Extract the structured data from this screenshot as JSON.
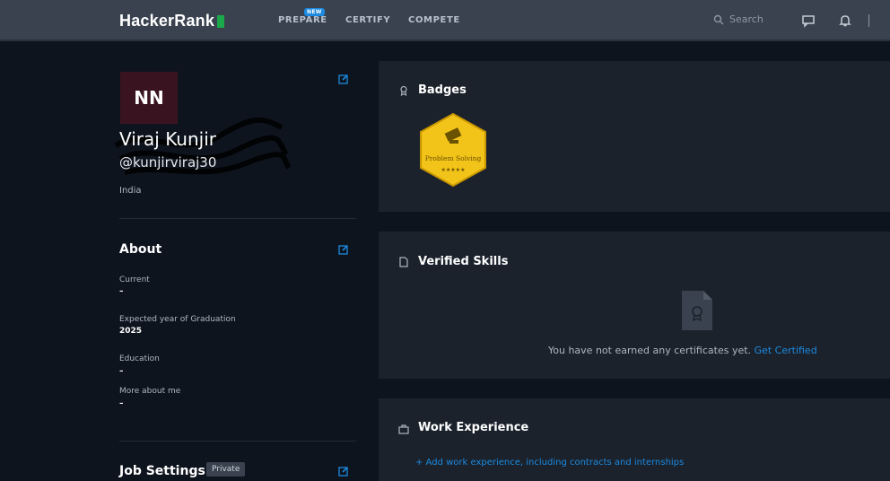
{
  "nav": {
    "brand": "HackerRank",
    "prepare": "PREPARE",
    "new_badge": "NEW",
    "certify": "CERTIFY",
    "compete": "COMPETE",
    "search_placeholder": "Search"
  },
  "profile": {
    "avatar_initials": "NN",
    "name": "Viraj Kunjir",
    "username": "@kunjirviraj30",
    "country": "India"
  },
  "about": {
    "title": "About",
    "fields": [
      {
        "label": "Current",
        "value": "–"
      },
      {
        "label": "Expected year of Graduation",
        "value": "2025"
      },
      {
        "label": "Education",
        "value": "–"
      },
      {
        "label": "More about me",
        "value": "–"
      }
    ]
  },
  "job_settings": {
    "title": "Job Settings",
    "visibility": "Private"
  },
  "badges": {
    "title": "Badges",
    "items": [
      {
        "name": "Problem Solving",
        "stars": 5,
        "color": "#f2c318"
      }
    ]
  },
  "verified_skills": {
    "title": "Verified Skills",
    "empty_message": "You have not earned any certificates yet.",
    "cta": "Get Certified"
  },
  "work_experience": {
    "title": "Work Experience",
    "add_link": "+ Add work experience, including contracts and internships"
  },
  "colors": {
    "background": "#0e141e",
    "panel": "#1b222c",
    "topbar": "#39424e",
    "accent": "#1c8ae0",
    "brand_green": "#1ba94c"
  }
}
